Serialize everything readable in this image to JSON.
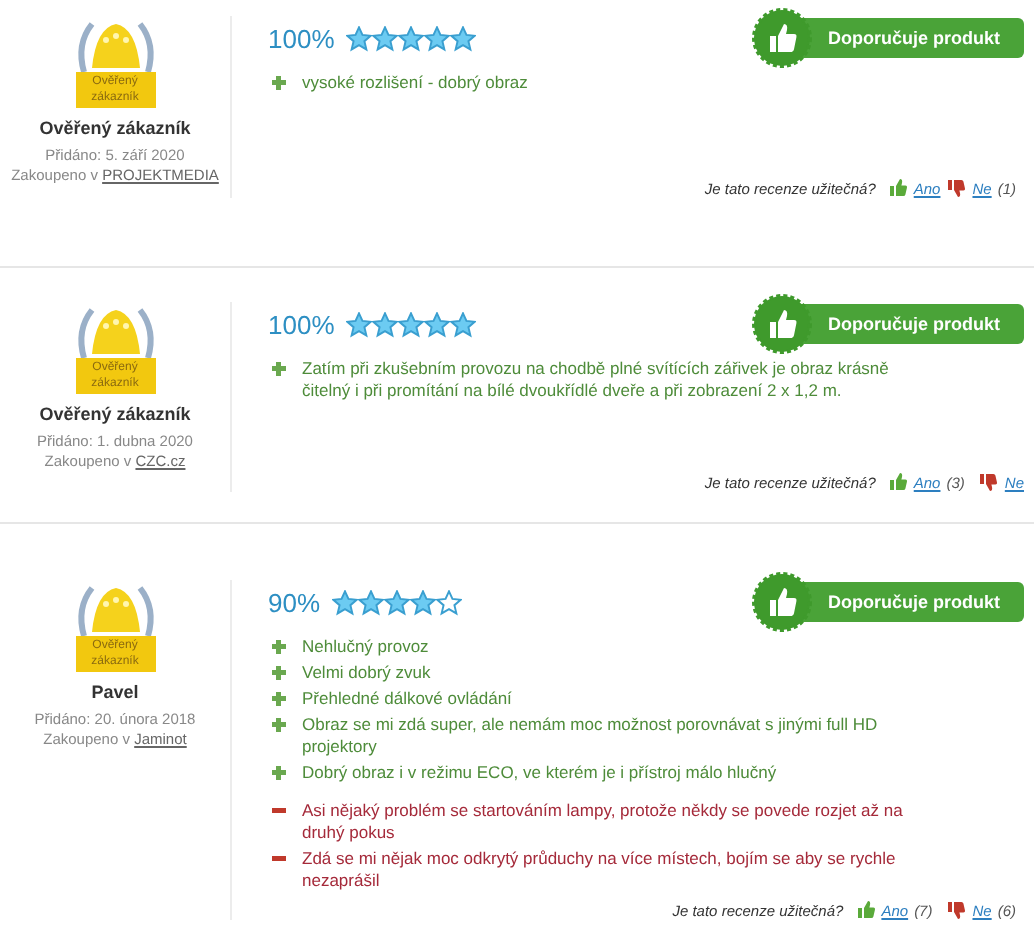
{
  "reviews": [
    {
      "badge_label": "Ověřený zákazník",
      "author": "Ověřený zákazník",
      "added": "Přidáno: 5. září 2020",
      "bought_prefix": "Zakoupeno v",
      "shop": "PROJEKTMEDIA",
      "percent": "100%",
      "stars": 5,
      "recommend": "Doporučuje produkt",
      "pros": [
        "vysoké rozlišení - dobrý obraz"
      ],
      "helpful_question": "Je tato recenze užitečná?",
      "yes": "Ano",
      "no": "Ne",
      "no_count": "(1)"
    },
    {
      "badge_label": "Ověřený zákazník",
      "author": "Ověřený zákazník",
      "added": "Přidáno: 1. dubna 2020",
      "bought_prefix": "Zakoupeno v",
      "shop": "CZC.cz",
      "percent": "100%",
      "stars": 5,
      "recommend": "Doporučuje produkt",
      "pros": [
        "Zatím při zkušebním provozu na chodbě plné svítících zářivek je obraz krásně čitelný i při promítání na bílé dvoukřídlé dveře a při zobrazení 2 x 1,2 m."
      ],
      "helpful_question": "Je tato recenze užitečná?",
      "yes": "Ano",
      "yes_count": "(3)",
      "no": "Ne"
    },
    {
      "badge_label": "Ověřený zákazník",
      "author": "Pavel",
      "added": "Přidáno: 20. února 2018",
      "bought_prefix": "Zakoupeno v",
      "shop": "Jaminot",
      "percent": "90%",
      "stars": 4,
      "recommend": "Doporučuje produkt",
      "pros": [
        "Nehlučný provoz",
        "Velmi dobrý zvuk",
        "Přehledné dálkové ovládání",
        "Obraz se mi zdá super, ale nemám moc možnost porovnávat s jinými full HD projektory",
        "Dobrý obraz i v režimu ECO, ve kterém je i přístroj málo hlučný"
      ],
      "cons": [
        "Asi nějaký problém se startováním lampy, protože někdy se povede rozjet až na druhý pokus",
        "Zdá se mi nějak moc odkrytý průduchy na více místech, bojím se aby se rychle nezaprášil"
      ],
      "helpful_question": "Je tato recenze užitečná?",
      "yes": "Ano",
      "yes_count": "(7)",
      "no": "Ne",
      "no_count": "(6)"
    }
  ]
}
